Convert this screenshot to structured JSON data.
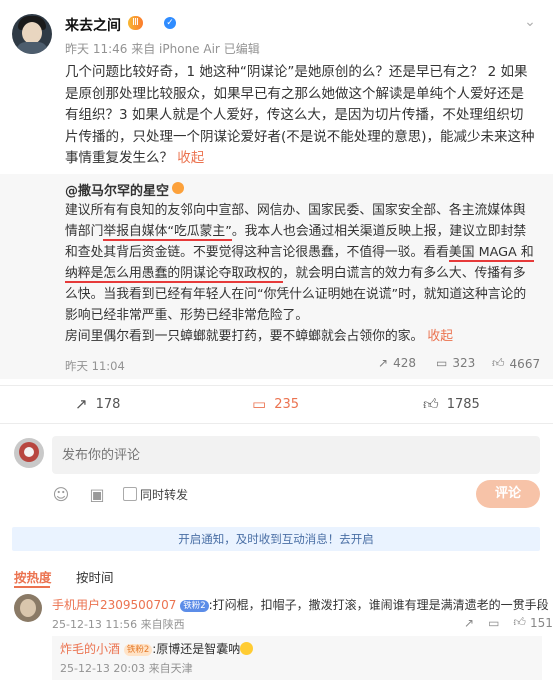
{
  "post": {
    "username": "来去之间",
    "badge": "Ⅲ",
    "time": "昨天 11:46",
    "source": "来自 iPhone Air",
    "edited": "已编辑",
    "text": "几个问题比较好奇，1 她这种“阴谋论”是她原创的么？还是早已有之？ 2 如果是原创那处理比较服众，如果早已有之那么她做这个解读是单纯个人爱好还是有组织？3 如果人就是个人爱好，传这么大，是因为切片传播，不处理组织切片传播的，只处理一个阴谋论爱好者(不是说不能处理的意思)，能减少未来这种事情重复发生么？",
    "collapse_label": "收起"
  },
  "quote": {
    "author": "@撒马尔罕的星空",
    "p1_a": "建议所有有良知的友邻向中宣部、网信办、国家民委、国家安全部、各主流媒体舆情部门",
    "p1_u1": "举报自媒体“吃瓜蒙主”",
    "p1_b": "。我本人也会通过相关渠道反映上报，建议立即封禁和查处其背后资金链。不要觉得这种言论很愚蠢，不值得一驳。看看",
    "p1_u2": "美国 MAGA 和纳粹是怎么用愚蠢的阴谋论夺取政权的",
    "p1_c": "，就会明白谎言的效力有多么大、传播有多么快。当我看到已经有年轻人在问“你凭什么证明她在说谎”时，就知道这种言论的影响已经非常严重、形势已经非常危险了。",
    "p2": "房间里偶尔看到一只蟑螂就要打药，要不蟑螂就会占领你的家。",
    "collapse_label": "收起",
    "time": "昨天 11:04",
    "reposts": "428",
    "comments": "323",
    "likes": "4667"
  },
  "actions": {
    "reposts": "178",
    "comments": "235",
    "likes": "1785"
  },
  "composer": {
    "placeholder": "发布你的评论",
    "repost_label": "同时转发",
    "submit_label": "评论"
  },
  "notice": "开启通知，及时收到互动消息！去开启",
  "tabs": [
    "按热度",
    "按时间"
  ],
  "comments": [
    {
      "user": "手机用户2309500707",
      "badge": "铁粉2",
      "text": ":打闷棍，扣帽子，撒泼打滚，谁闹谁有理是满清遗老的一贯手段",
      "time": "25-12-13 11:56",
      "location": "来自陕西",
      "likes": "151"
    }
  ],
  "reply": {
    "user": "炸毛的小酒",
    "badge": "铁粉2",
    "text": ":原博还是智囊呐",
    "time": "25-12-13 20:03",
    "location": "来自天津"
  },
  "colors": {
    "accent": "#eb7350",
    "verify": "#2f8cff",
    "underline": "#e63a3a"
  }
}
